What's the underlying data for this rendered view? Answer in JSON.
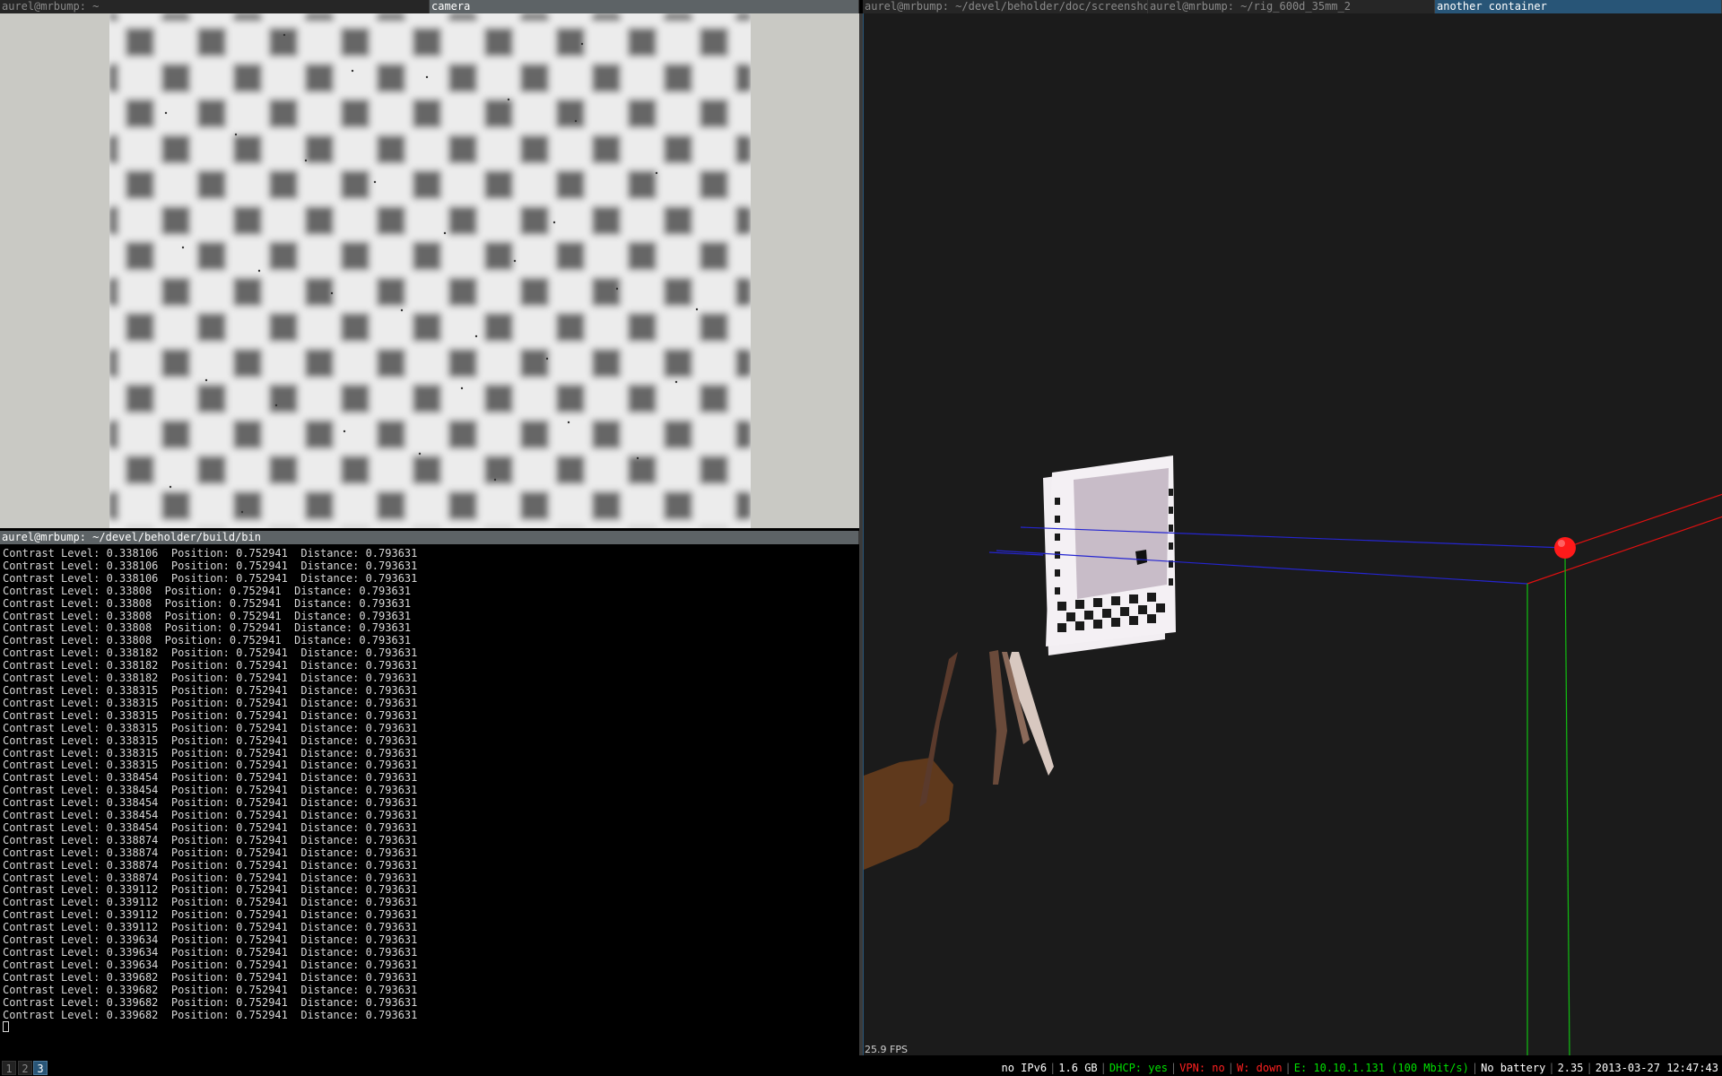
{
  "top_tabs": {
    "left": [
      {
        "title": "aurel@mrbump: ~",
        "state": "inactive"
      },
      {
        "title": "camera",
        "state": "active"
      }
    ],
    "right": [
      {
        "title": "aurel@mrbump: ~/devel/beholder/doc/screenshots",
        "state": "inactive"
      },
      {
        "title": "aurel@mrbump: ~/rig_600d_35mm_2",
        "state": "inactive"
      },
      {
        "title": "another container",
        "state": "focused"
      }
    ]
  },
  "terminal": {
    "title": "aurel@mrbump: ~/devel/beholder/build/bin",
    "lines": [
      "Contrast Level: 0.338106  Position: 0.752941  Distance: 0.793631",
      "Contrast Level: 0.338106  Position: 0.752941  Distance: 0.793631",
      "Contrast Level: 0.338106  Position: 0.752941  Distance: 0.793631",
      "Contrast Level: 0.33808  Position: 0.752941  Distance: 0.793631",
      "Contrast Level: 0.33808  Position: 0.752941  Distance: 0.793631",
      "Contrast Level: 0.33808  Position: 0.752941  Distance: 0.793631",
      "Contrast Level: 0.33808  Position: 0.752941  Distance: 0.793631",
      "Contrast Level: 0.33808  Position: 0.752941  Distance: 0.793631",
      "Contrast Level: 0.338182  Position: 0.752941  Distance: 0.793631",
      "Contrast Level: 0.338182  Position: 0.752941  Distance: 0.793631",
      "Contrast Level: 0.338182  Position: 0.752941  Distance: 0.793631",
      "Contrast Level: 0.338315  Position: 0.752941  Distance: 0.793631",
      "Contrast Level: 0.338315  Position: 0.752941  Distance: 0.793631",
      "Contrast Level: 0.338315  Position: 0.752941  Distance: 0.793631",
      "Contrast Level: 0.338315  Position: 0.752941  Distance: 0.793631",
      "Contrast Level: 0.338315  Position: 0.752941  Distance: 0.793631",
      "Contrast Level: 0.338315  Position: 0.752941  Distance: 0.793631",
      "Contrast Level: 0.338315  Position: 0.752941  Distance: 0.793631",
      "Contrast Level: 0.338454  Position: 0.752941  Distance: 0.793631",
      "Contrast Level: 0.338454  Position: 0.752941  Distance: 0.793631",
      "Contrast Level: 0.338454  Position: 0.752941  Distance: 0.793631",
      "Contrast Level: 0.338454  Position: 0.752941  Distance: 0.793631",
      "Contrast Level: 0.338454  Position: 0.752941  Distance: 0.793631",
      "Contrast Level: 0.338874  Position: 0.752941  Distance: 0.793631",
      "Contrast Level: 0.338874  Position: 0.752941  Distance: 0.793631",
      "Contrast Level: 0.338874  Position: 0.752941  Distance: 0.793631",
      "Contrast Level: 0.338874  Position: 0.752941  Distance: 0.793631",
      "Contrast Level: 0.339112  Position: 0.752941  Distance: 0.793631",
      "Contrast Level: 0.339112  Position: 0.752941  Distance: 0.793631",
      "Contrast Level: 0.339112  Position: 0.752941  Distance: 0.793631",
      "Contrast Level: 0.339112  Position: 0.752941  Distance: 0.793631",
      "Contrast Level: 0.339634  Position: 0.752941  Distance: 0.793631",
      "Contrast Level: 0.339634  Position: 0.752941  Distance: 0.793631",
      "Contrast Level: 0.339634  Position: 0.752941  Distance: 0.793631",
      "Contrast Level: 0.339682  Position: 0.752941  Distance: 0.793631",
      "Contrast Level: 0.339682  Position: 0.752941  Distance: 0.793631",
      "Contrast Level: 0.339682  Position: 0.752941  Distance: 0.793631",
      "Contrast Level: 0.339682  Position: 0.752941  Distance: 0.793631"
    ]
  },
  "scene": {
    "fps": "25.9 FPS",
    "colors": {
      "background": "#1b1b1b",
      "ray": "#2020d0",
      "axis_x": "#e01010",
      "axis_y": "#10c010",
      "marker": "#ff1a1a"
    }
  },
  "statusbar": {
    "workspaces": [
      {
        "label": "1",
        "active": false
      },
      {
        "label": "2",
        "active": false
      },
      {
        "label": "3",
        "active": true
      }
    ],
    "items": [
      {
        "text": "no IPv6",
        "color": "white"
      },
      {
        "text": "1.6 GB",
        "color": "white"
      },
      {
        "text": "DHCP: yes",
        "color": "green"
      },
      {
        "text": "VPN: no",
        "color": "red"
      },
      {
        "text": "W: down",
        "color": "red"
      },
      {
        "text": "E: 10.10.1.131 (100 Mbit/s)",
        "color": "green"
      },
      {
        "text": "No battery",
        "color": "white"
      },
      {
        "text": "2.35",
        "color": "white"
      },
      {
        "text": "2013-03-27 12:47:43",
        "color": "white"
      }
    ]
  }
}
